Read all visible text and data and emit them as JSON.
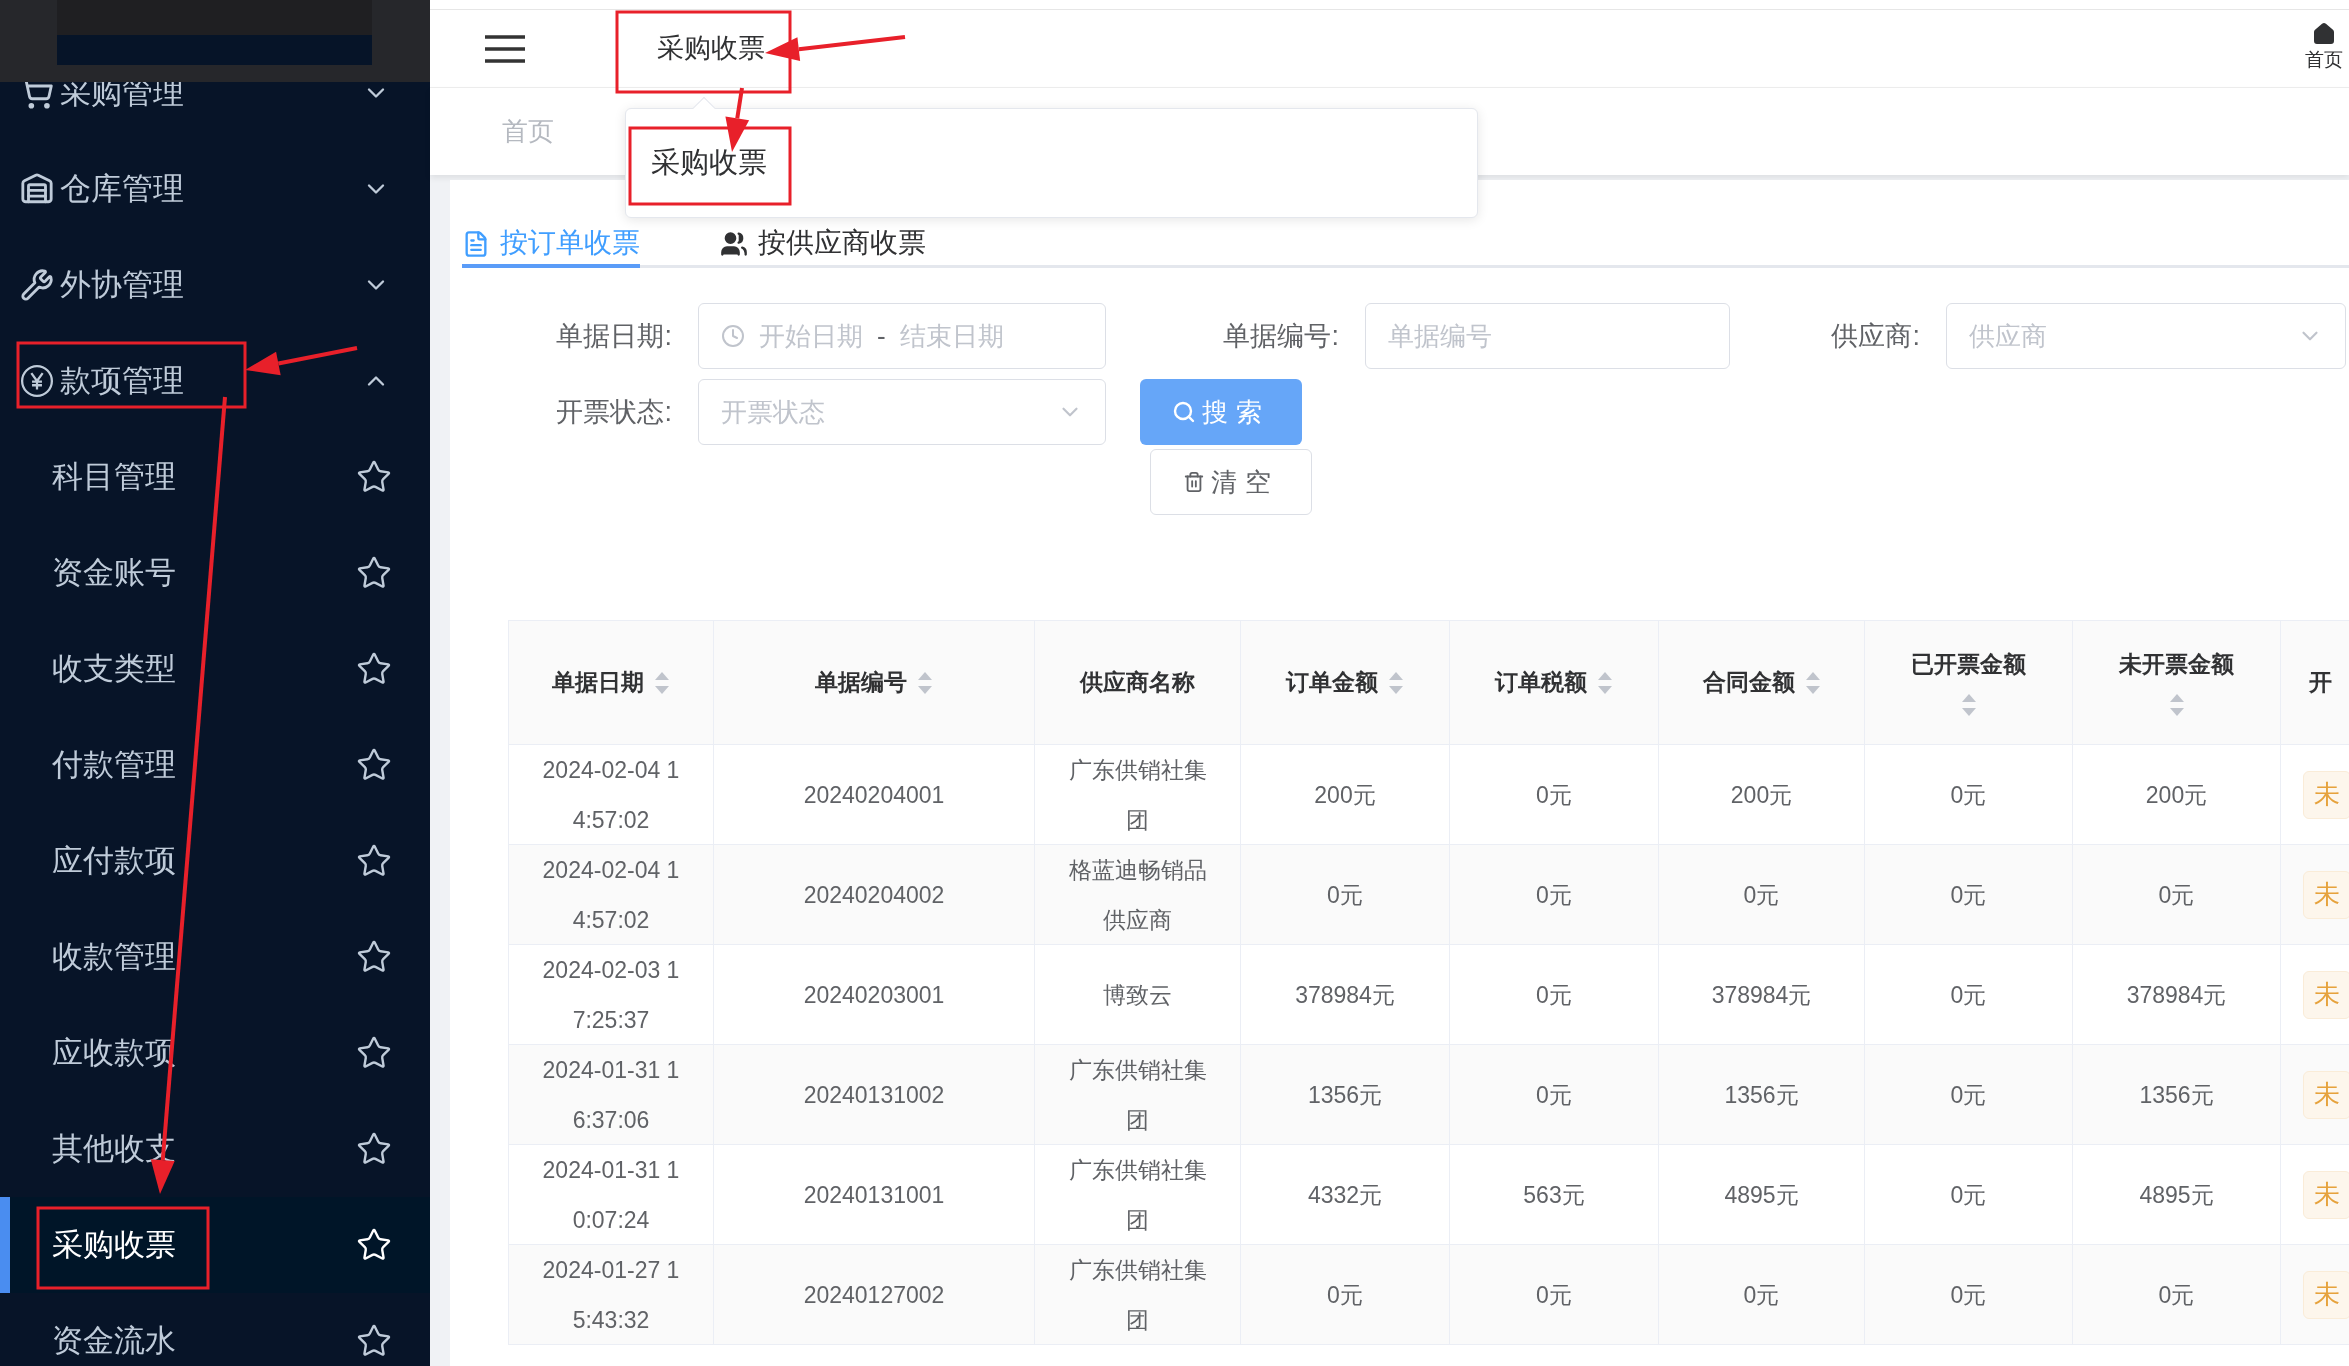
{
  "sidebar": {
    "groups": [
      {
        "label": "采购管理",
        "expanded": false
      },
      {
        "label": "仓库管理",
        "expanded": false
      },
      {
        "label": "外协管理",
        "expanded": false
      },
      {
        "label": "款项管理",
        "expanded": true,
        "children": [
          {
            "label": "科目管理",
            "selected": false
          },
          {
            "label": "资金账号",
            "selected": false
          },
          {
            "label": "收支类型",
            "selected": false
          },
          {
            "label": "付款管理",
            "selected": false
          },
          {
            "label": "应付款项",
            "selected": false
          },
          {
            "label": "收款管理",
            "selected": false
          },
          {
            "label": "应收款项",
            "selected": false
          },
          {
            "label": "其他收支",
            "selected": false
          },
          {
            "label": "采购收票",
            "selected": true
          },
          {
            "label": "资金流水",
            "selected": false
          }
        ]
      }
    ]
  },
  "header": {
    "breadcrumb": "采购收票",
    "home_label": "首页"
  },
  "tags_bar": {
    "tags": [
      "首页"
    ]
  },
  "breadcrumb_popup": {
    "items": [
      "采购收票"
    ]
  },
  "tabs": [
    {
      "label": "按订单收票",
      "selected": true
    },
    {
      "label": "按供应商收票",
      "selected": false
    }
  ],
  "filters": {
    "fields": [
      {
        "kind": "daterange",
        "label": "单据日期:",
        "start_placeholder": "开始日期",
        "separator": "-",
        "end_placeholder": "结束日期"
      },
      {
        "kind": "text",
        "label": "单据编号:",
        "placeholder": "单据编号"
      },
      {
        "kind": "select",
        "label": "供应商:",
        "placeholder": "供应商"
      },
      {
        "kind": "select",
        "label": "开票状态:",
        "placeholder": "开票状态"
      }
    ],
    "search_button": "搜索",
    "clear_button": "清空"
  },
  "table": {
    "columns": [
      {
        "label": "单据日期",
        "sortable": true
      },
      {
        "label": "单据编号",
        "sortable": true
      },
      {
        "label": "供应商名称",
        "sortable": false
      },
      {
        "label": "订单金额",
        "sortable": true
      },
      {
        "label": "订单税额",
        "sortable": true
      },
      {
        "label": "合同金额",
        "sortable": true
      },
      {
        "label": "已开票金额",
        "sortable": true
      },
      {
        "label": "未开票金额",
        "sortable": true
      },
      {
        "label": "开",
        "sortable": false
      }
    ],
    "rows": [
      {
        "cells": [
          "2024-02-04 14:57:02",
          "20240204001",
          "广东供销社集团",
          "200元",
          "0元",
          "200元",
          "0元",
          "200元"
        ],
        "status": "未"
      },
      {
        "cells": [
          "2024-02-04 14:57:02",
          "20240204002",
          "格蓝迪畅销品供应商",
          "0元",
          "0元",
          "0元",
          "0元",
          "0元"
        ],
        "status": "未"
      },
      {
        "cells": [
          "2024-02-03 17:25:37",
          "20240203001",
          "博致云",
          "378984元",
          "0元",
          "378984元",
          "0元",
          "378984元"
        ],
        "status": "未"
      },
      {
        "cells": [
          "2024-01-31 16:37:06",
          "20240131002",
          "广东供销社集团",
          "1356元",
          "0元",
          "1356元",
          "0元",
          "1356元"
        ],
        "status": "未"
      },
      {
        "cells": [
          "2024-01-31 10:07:24",
          "20240131001",
          "广东供销社集团",
          "4332元",
          "563元",
          "4895元",
          "0元",
          "4895元"
        ],
        "status": "未"
      },
      {
        "cells": [
          "2024-01-27 15:43:32",
          "20240127002",
          "广东供销社集团",
          "0元",
          "0元",
          "0元",
          "0元",
          "0元"
        ],
        "status": "未"
      }
    ]
  }
}
